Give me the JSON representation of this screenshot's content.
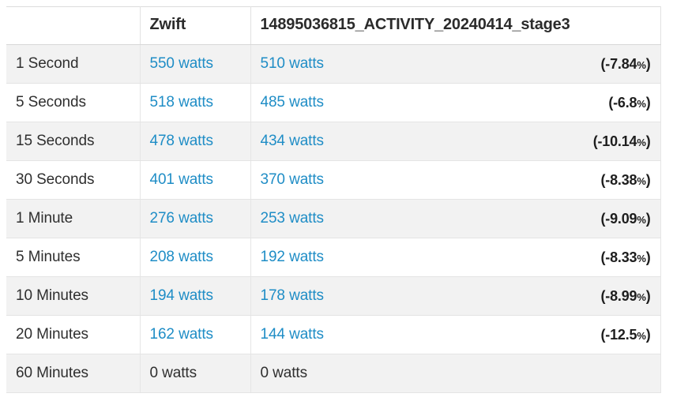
{
  "table": {
    "columns": [
      {
        "key": "interval",
        "label": ""
      },
      {
        "key": "zwift",
        "label": "Zwift"
      },
      {
        "key": "activity",
        "label": "14895036815_ACTIVITY_20240414_stage3"
      }
    ],
    "unit": "watts",
    "accent_color": "#1f8dc6",
    "text_color": "#2f2f2f",
    "stripe_color": "#f2f2f2",
    "rows": [
      {
        "interval": "1 Second",
        "zwift": "550 watts",
        "activity": "510 watts",
        "delta": "(-7.84",
        "delta_pct": "%",
        "delta_close": ")"
      },
      {
        "interval": "5 Seconds",
        "zwift": "518 watts",
        "activity": "485 watts",
        "delta": "(-6.8",
        "delta_pct": "%",
        "delta_close": ")"
      },
      {
        "interval": "15 Seconds",
        "zwift": "478 watts",
        "activity": "434 watts",
        "delta": "(-10.14",
        "delta_pct": "%",
        "delta_close": ")"
      },
      {
        "interval": "30 Seconds",
        "zwift": "401 watts",
        "activity": "370 watts",
        "delta": "(-8.38",
        "delta_pct": "%",
        "delta_close": ")"
      },
      {
        "interval": "1 Minute",
        "zwift": "276 watts",
        "activity": "253 watts",
        "delta": "(-9.09",
        "delta_pct": "%",
        "delta_close": ")"
      },
      {
        "interval": "5 Minutes",
        "zwift": "208 watts",
        "activity": "192 watts",
        "delta": "(-8.33",
        "delta_pct": "%",
        "delta_close": ")"
      },
      {
        "interval": "10 Minutes",
        "zwift": "194 watts",
        "activity": "178 watts",
        "delta": "(-8.99",
        "delta_pct": "%",
        "delta_close": ")"
      },
      {
        "interval": "20 Minutes",
        "zwift": "162 watts",
        "activity": "144 watts",
        "delta": "(-12.5",
        "delta_pct": "%",
        "delta_close": ")"
      },
      {
        "interval": "60 Minutes",
        "zwift": "0 watts",
        "activity": "0 watts",
        "delta": "",
        "delta_pct": "",
        "delta_close": ""
      }
    ]
  }
}
